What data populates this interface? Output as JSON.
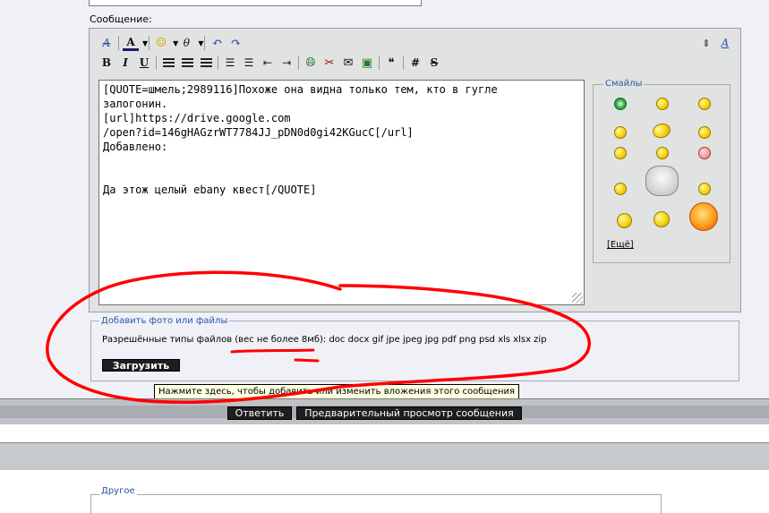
{
  "form": {
    "message_label": "Сообщение:"
  },
  "toolbar": {
    "row1": [
      {
        "name": "remove-format-icon",
        "glyph": "A̸"
      },
      {
        "name": "font-color-icon",
        "glyph": "A"
      },
      {
        "name": "smiley-menu-icon",
        "glyph": "☺"
      },
      {
        "name": "insert-icon",
        "glyph": "θ"
      },
      {
        "name": "undo-icon",
        "glyph": "↶"
      },
      {
        "name": "redo-icon",
        "glyph": "↷"
      }
    ],
    "row2": [
      {
        "name": "bold-icon",
        "glyph": "B"
      },
      {
        "name": "italic-icon",
        "glyph": "I"
      },
      {
        "name": "underline-icon",
        "glyph": "U"
      },
      {
        "name": "align-left-icon",
        "glyph": "≡"
      },
      {
        "name": "align-center-icon",
        "glyph": "≡"
      },
      {
        "name": "align-right-icon",
        "glyph": "≡"
      },
      {
        "name": "numbered-list-icon",
        "glyph": "☰"
      },
      {
        "name": "bullet-list-icon",
        "glyph": "☰"
      },
      {
        "name": "outdent-icon",
        "glyph": "⇤"
      },
      {
        "name": "indent-icon",
        "glyph": "⇥"
      },
      {
        "name": "insert-link-icon",
        "glyph": "⊕"
      },
      {
        "name": "remove-link-icon",
        "glyph": "✂"
      },
      {
        "name": "insert-email-icon",
        "glyph": "✉"
      },
      {
        "name": "insert-image-icon",
        "glyph": "▣"
      },
      {
        "name": "quote-icon",
        "glyph": "❝"
      },
      {
        "name": "wrap-code-icon",
        "glyph": "#"
      },
      {
        "name": "strikethrough-icon",
        "glyph": "S̶"
      }
    ],
    "resize_icon_glyph": "⇕",
    "font-style-icon_glyph": "A"
  },
  "editor": {
    "content": "[QUOTE=шмель;2989116]Похоже она видна только тем, кто в гугле\nзалогонин.\n[url]https://drive.google.com\n/open?id=146gHAGzrWT7784JJ_pDN0d0gi42KGucC[/url]\nДобавлено:\n\n\nДа этож целый ebany квест[/QUOTE]"
  },
  "smilies": {
    "legend": "Смайлы",
    "more_link": "[Ещё]"
  },
  "attachments": {
    "legend": "Добавить фото или файлы",
    "allowed_types": "Разрешённые типы файлов (вес не более 8мб): doc docx gif jpe jpeg jpg pdf png psd xls xlsx zip",
    "upload_button": "Загрузить",
    "tooltip": "Нажмите здесь, чтобы добавить или изменить вложения этого сообщения"
  },
  "actions": {
    "submit_button": "Ответить",
    "preview_button": "Предварительный просмотр сообщения"
  },
  "other": {
    "legend": "Другое"
  },
  "colors": {
    "accent_legend": "#2a54a8",
    "annotation_red": "#ff0000"
  }
}
